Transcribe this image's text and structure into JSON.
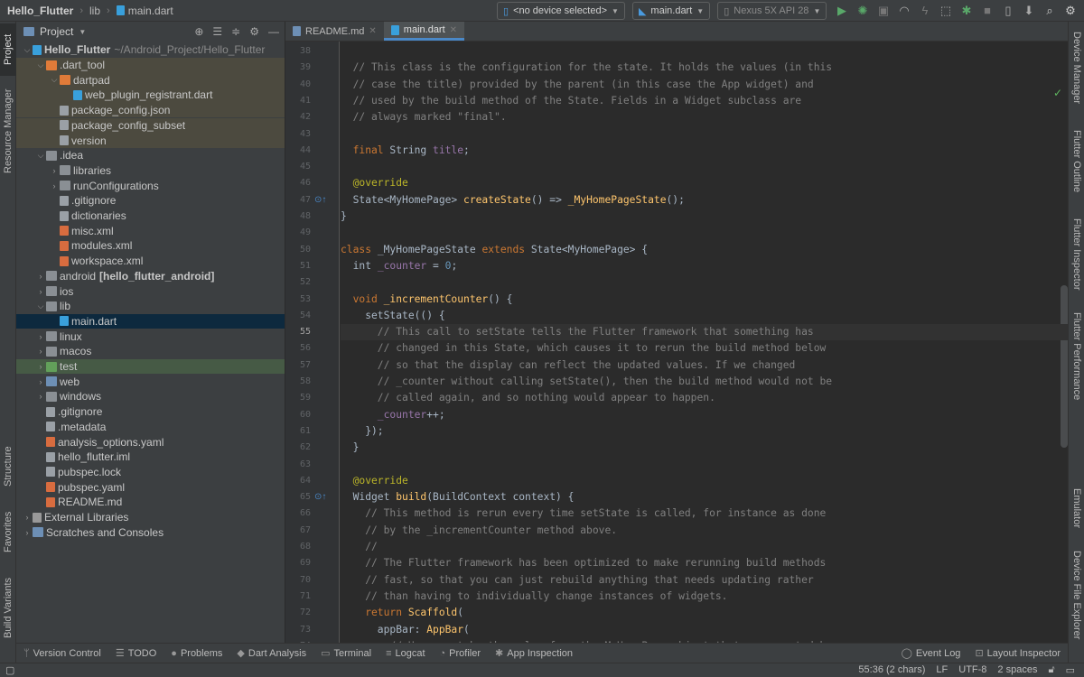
{
  "breadcrumbs": {
    "project": "Hello_Flutter",
    "folder": "lib",
    "file": "main.dart"
  },
  "toolbar": {
    "device": "<no device selected>",
    "config": "main.dart",
    "emulator": "Nexus 5X API 28"
  },
  "left_tabs": {
    "project": "Project",
    "resource_manager": "Resource Manager",
    "structure": "Structure",
    "favorites": "Favorites",
    "build_variants": "Build Variants"
  },
  "right_tabs": {
    "device_manager": "Device Manager",
    "flutter_outline": "Flutter Outline",
    "flutter_inspector": "Flutter Inspector",
    "flutter_performance": "Flutter Performance",
    "emulator": "Emulator",
    "device_file_explorer": "Device File Explorer"
  },
  "project_panel": {
    "title": "Project",
    "root_name": "Hello_Flutter",
    "root_path": "~/Android_Project/Hello_Flutter",
    "items": [
      {
        "label": "Hello_Flutter",
        "extra": "~/Android_Project/Hello_Flutter",
        "indent": 0,
        "arrow": "open",
        "icon": "dart",
        "bold": true,
        "state": ""
      },
      {
        "label": ".dart_tool",
        "extra": "",
        "indent": 1,
        "arrow": "open",
        "icon": "folder-o",
        "bold": false,
        "state": "hl"
      },
      {
        "label": "dartpad",
        "extra": "",
        "indent": 2,
        "arrow": "open",
        "icon": "folder-o",
        "bold": false,
        "state": "hl"
      },
      {
        "label": "web_plugin_registrant.dart",
        "extra": "",
        "indent": 3,
        "arrow": "",
        "icon": "dart",
        "bold": false,
        "state": "hl"
      },
      {
        "label": "package_config.json",
        "extra": "",
        "indent": 2,
        "arrow": "",
        "icon": "file",
        "bold": false,
        "state": "hl"
      },
      {
        "label": "package_config_subset",
        "extra": "",
        "indent": 2,
        "arrow": "",
        "icon": "file",
        "bold": false,
        "state": "hl"
      },
      {
        "label": "version",
        "extra": "",
        "indent": 2,
        "arrow": "",
        "icon": "file",
        "bold": false,
        "state": "hl"
      },
      {
        "label": ".idea",
        "extra": "",
        "indent": 1,
        "arrow": "open",
        "icon": "folder",
        "bold": false,
        "state": ""
      },
      {
        "label": "libraries",
        "extra": "",
        "indent": 2,
        "arrow": "closed",
        "icon": "folder",
        "bold": false,
        "state": ""
      },
      {
        "label": "runConfigurations",
        "extra": "",
        "indent": 2,
        "arrow": "closed",
        "icon": "folder",
        "bold": false,
        "state": ""
      },
      {
        "label": ".gitignore",
        "extra": "",
        "indent": 2,
        "arrow": "",
        "icon": "file",
        "bold": false,
        "state": ""
      },
      {
        "label": "dictionaries",
        "extra": "",
        "indent": 2,
        "arrow": "",
        "icon": "file",
        "bold": false,
        "state": ""
      },
      {
        "label": "misc.xml",
        "extra": "",
        "indent": 2,
        "arrow": "",
        "icon": "xml",
        "bold": false,
        "state": ""
      },
      {
        "label": "modules.xml",
        "extra": "",
        "indent": 2,
        "arrow": "",
        "icon": "xml",
        "bold": false,
        "state": ""
      },
      {
        "label": "workspace.xml",
        "extra": "",
        "indent": 2,
        "arrow": "",
        "icon": "xml",
        "bold": false,
        "state": ""
      },
      {
        "label": "android",
        "extra": "[hello_flutter_android]",
        "indent": 1,
        "arrow": "closed",
        "icon": "folder",
        "bold": false,
        "state": ""
      },
      {
        "label": "ios",
        "extra": "",
        "indent": 1,
        "arrow": "closed",
        "icon": "folder",
        "bold": false,
        "state": ""
      },
      {
        "label": "lib",
        "extra": "",
        "indent": 1,
        "arrow": "open",
        "icon": "folder",
        "bold": false,
        "state": ""
      },
      {
        "label": "main.dart",
        "extra": "",
        "indent": 2,
        "arrow": "",
        "icon": "dart",
        "bold": false,
        "state": "sel"
      },
      {
        "label": "linux",
        "extra": "",
        "indent": 1,
        "arrow": "closed",
        "icon": "folder",
        "bold": false,
        "state": ""
      },
      {
        "label": "macos",
        "extra": "",
        "indent": 1,
        "arrow": "closed",
        "icon": "folder",
        "bold": false,
        "state": ""
      },
      {
        "label": "test",
        "extra": "",
        "indent": 1,
        "arrow": "closed",
        "icon": "folder-g",
        "bold": false,
        "state": "green"
      },
      {
        "label": "web",
        "extra": "",
        "indent": 1,
        "arrow": "closed",
        "icon": "folder-b",
        "bold": false,
        "state": ""
      },
      {
        "label": "windows",
        "extra": "",
        "indent": 1,
        "arrow": "closed",
        "icon": "folder",
        "bold": false,
        "state": ""
      },
      {
        "label": ".gitignore",
        "extra": "",
        "indent": 1,
        "arrow": "",
        "icon": "file",
        "bold": false,
        "state": ""
      },
      {
        "label": ".metadata",
        "extra": "",
        "indent": 1,
        "arrow": "",
        "icon": "file",
        "bold": false,
        "state": ""
      },
      {
        "label": "analysis_options.yaml",
        "extra": "",
        "indent": 1,
        "arrow": "",
        "icon": "xml",
        "bold": false,
        "state": ""
      },
      {
        "label": "hello_flutter.iml",
        "extra": "",
        "indent": 1,
        "arrow": "",
        "icon": "file",
        "bold": false,
        "state": ""
      },
      {
        "label": "pubspec.lock",
        "extra": "",
        "indent": 1,
        "arrow": "",
        "icon": "file",
        "bold": false,
        "state": ""
      },
      {
        "label": "pubspec.yaml",
        "extra": "",
        "indent": 1,
        "arrow": "",
        "icon": "xml",
        "bold": false,
        "state": ""
      },
      {
        "label": "README.md",
        "extra": "",
        "indent": 1,
        "arrow": "",
        "icon": "xml",
        "bold": false,
        "state": ""
      },
      {
        "label": "External Libraries",
        "extra": "",
        "indent": 0,
        "arrow": "closed",
        "icon": "lib",
        "bold": false,
        "state": ""
      },
      {
        "label": "Scratches and Consoles",
        "extra": "",
        "indent": 0,
        "arrow": "closed",
        "icon": "folder-b",
        "bold": false,
        "state": ""
      }
    ]
  },
  "editor_tabs": [
    {
      "label": "README.md",
      "active": false
    },
    {
      "label": "main.dart",
      "active": true
    }
  ],
  "code": {
    "current_line": 55,
    "lines": [
      {
        "n": 38,
        "segs": []
      },
      {
        "n": 39,
        "segs": [
          [
            "c-com",
            "  // This class is the configuration for the state. It holds the values (in this"
          ]
        ]
      },
      {
        "n": 40,
        "segs": [
          [
            "c-com",
            "  // case the title) provided by the parent (in this case the App widget) and"
          ]
        ]
      },
      {
        "n": 41,
        "segs": [
          [
            "c-com",
            "  // used by the build method of the State. Fields in a Widget subclass are"
          ]
        ]
      },
      {
        "n": 42,
        "segs": [
          [
            "c-com",
            "  // always marked \"final\"."
          ]
        ]
      },
      {
        "n": 43,
        "segs": []
      },
      {
        "n": 44,
        "segs": [
          [
            "c-kw",
            "  final "
          ],
          [
            "",
            "String "
          ],
          [
            "c-fld",
            "title"
          ],
          [
            "",
            ";"
          ]
        ]
      },
      {
        "n": 45,
        "segs": []
      },
      {
        "n": 46,
        "segs": [
          [
            "c-an",
            "  @override"
          ]
        ]
      },
      {
        "n": 47,
        "segs": [
          [
            "",
            "  State<MyHomePage> "
          ],
          [
            "c-fn",
            "createState"
          ],
          [
            "",
            "() => "
          ],
          [
            "c-fn",
            "_MyHomePageState"
          ],
          [
            "",
            "();"
          ]
        ]
      },
      {
        "n": 48,
        "segs": [
          [
            "",
            "}"
          ]
        ]
      },
      {
        "n": 49,
        "segs": []
      },
      {
        "n": 50,
        "segs": [
          [
            "c-kw",
            "class "
          ],
          [
            "",
            "_MyHomePageState "
          ],
          [
            "c-kw",
            "extends "
          ],
          [
            "",
            "State<MyHomePage> {"
          ]
        ]
      },
      {
        "n": 51,
        "segs": [
          [
            "",
            "  int "
          ],
          [
            "c-fld",
            "_counter"
          ],
          [
            "",
            " = "
          ],
          [
            "c-num",
            "0"
          ],
          [
            "",
            ";"
          ]
        ]
      },
      {
        "n": 52,
        "segs": []
      },
      {
        "n": 53,
        "segs": [
          [
            "c-kw",
            "  void "
          ],
          [
            "c-fn",
            "_incrementCounter"
          ],
          [
            "",
            "() {"
          ]
        ]
      },
      {
        "n": 54,
        "segs": [
          [
            "",
            "    setState(() {"
          ]
        ]
      },
      {
        "n": 55,
        "segs": [
          [
            "c-com",
            "      // This call to setState tells the Flutter framework that something has"
          ]
        ]
      },
      {
        "n": 56,
        "segs": [
          [
            "c-com",
            "      // changed in this State, which causes it to rerun the build method below"
          ]
        ]
      },
      {
        "n": 57,
        "segs": [
          [
            "c-com",
            "      // so that the display can reflect the updated values. If we changed"
          ]
        ]
      },
      {
        "n": 58,
        "segs": [
          [
            "c-com",
            "      // _counter without calling setState(), then the build method would not be"
          ]
        ]
      },
      {
        "n": 59,
        "segs": [
          [
            "c-com",
            "      // called again, and so nothing would appear to happen."
          ]
        ]
      },
      {
        "n": 60,
        "segs": [
          [
            "c-fld",
            "      _counter"
          ],
          [
            "",
            "++;"
          ]
        ]
      },
      {
        "n": 61,
        "segs": [
          [
            "",
            "    });"
          ]
        ]
      },
      {
        "n": 62,
        "segs": [
          [
            "",
            "  }"
          ]
        ]
      },
      {
        "n": 63,
        "segs": []
      },
      {
        "n": 64,
        "segs": [
          [
            "c-an",
            "  @override"
          ]
        ]
      },
      {
        "n": 65,
        "segs": [
          [
            "",
            "  Widget "
          ],
          [
            "c-fn",
            "build"
          ],
          [
            "",
            "(BuildContext context) {"
          ]
        ]
      },
      {
        "n": 66,
        "segs": [
          [
            "c-com",
            "    // This method is rerun every time setState is called, for instance as done"
          ]
        ]
      },
      {
        "n": 67,
        "segs": [
          [
            "c-com",
            "    // by the _incrementCounter method above."
          ]
        ]
      },
      {
        "n": 68,
        "segs": [
          [
            "c-com",
            "    //"
          ]
        ]
      },
      {
        "n": 69,
        "segs": [
          [
            "c-com",
            "    // The Flutter framework has been optimized to make rerunning build methods"
          ]
        ]
      },
      {
        "n": 70,
        "segs": [
          [
            "c-com",
            "    // fast, so that you can just rebuild anything that needs updating rather"
          ]
        ]
      },
      {
        "n": 71,
        "segs": [
          [
            "c-com",
            "    // than having to individually change instances of widgets."
          ]
        ]
      },
      {
        "n": 72,
        "segs": [
          [
            "c-kw",
            "    return "
          ],
          [
            "c-fn",
            "Scaffold"
          ],
          [
            "",
            "("
          ]
        ]
      },
      {
        "n": 73,
        "segs": [
          [
            "",
            "      appBar: "
          ],
          [
            "c-fn",
            "AppBar"
          ],
          [
            "",
            "("
          ]
        ]
      },
      {
        "n": 74,
        "segs": [
          [
            "c-com",
            "        // Here we take the value from the MyHomePage object that was created by"
          ]
        ]
      }
    ]
  },
  "tool_windows": [
    {
      "label": "Version Control",
      "icon": "branch-icon",
      "glyph": "ᛘ"
    },
    {
      "label": "TODO",
      "icon": "list-icon",
      "glyph": "☰"
    },
    {
      "label": "Problems",
      "icon": "problems-icon",
      "glyph": "●"
    },
    {
      "label": "Dart Analysis",
      "icon": "dart-analysis-icon",
      "glyph": "◆"
    },
    {
      "label": "Terminal",
      "icon": "terminal-icon",
      "glyph": "▭"
    },
    {
      "label": "Logcat",
      "icon": "logcat-icon",
      "glyph": "≡"
    },
    {
      "label": "Profiler",
      "icon": "profiler-icon",
      "glyph": "◔"
    },
    {
      "label": "App Inspection",
      "icon": "app-inspection-icon",
      "glyph": "✱"
    }
  ],
  "tool_windows_right": [
    {
      "label": "Event Log",
      "icon": "event-log-icon",
      "glyph": "◯"
    },
    {
      "label": "Layout Inspector",
      "icon": "layout-inspector-icon",
      "glyph": "⊡"
    }
  ],
  "status": {
    "position": "55:36 (2 chars)",
    "line_sep": "LF",
    "encoding": "UTF-8",
    "indent": "2 spaces"
  },
  "colors": {
    "accent": "#4a88c7",
    "comment": "#808080",
    "keyword": "#cc7832",
    "function": "#ffc66d"
  }
}
